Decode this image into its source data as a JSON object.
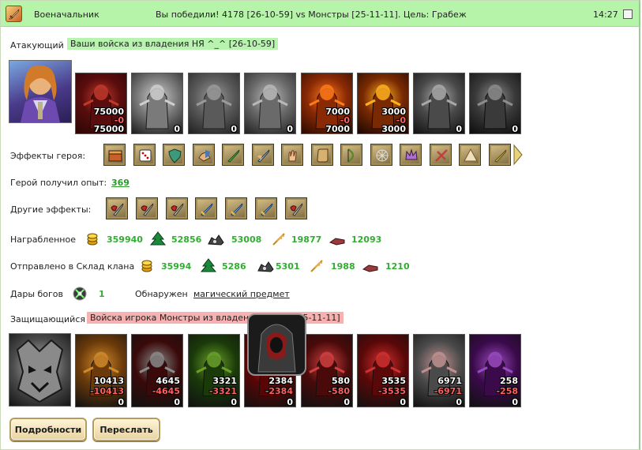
{
  "header": {
    "title": "Военачальник",
    "result": "Вы победили! 4178 [26-10-59] vs Монстры [25-11-11]. Цель: Грабеж",
    "time": "14:27",
    "colors": {
      "bg": "#b6f5a9"
    }
  },
  "attacker": {
    "label": "Атакующий",
    "tag": "Ваши войска из владения НЯ ^_^ [26-10-59]",
    "units": [
      {
        "icon": "red-dragon",
        "count": "75000",
        "loss": "-0",
        "remain": "75000"
      },
      {
        "icon": "skeleton-warrior",
        "count": "",
        "loss": "",
        "remain": "0"
      },
      {
        "icon": "ghoul",
        "count": "",
        "loss": "",
        "remain": "0"
      },
      {
        "icon": "gargoyle",
        "count": "",
        "loss": "",
        "remain": "0"
      },
      {
        "icon": "fire-elemental",
        "count": "7000",
        "loss": "-0",
        "remain": "7000"
      },
      {
        "icon": "fire-warrior",
        "count": "3000",
        "loss": "-0",
        "remain": "3000"
      },
      {
        "icon": "dark-knight",
        "count": "",
        "loss": "",
        "remain": "0"
      },
      {
        "icon": "hooded-reaper",
        "count": "",
        "loss": "",
        "remain": "0"
      }
    ]
  },
  "hero_effects": {
    "label": "Эффекты героя:",
    "icons": [
      "chest-icon",
      "dice-icon",
      "shield-icon",
      "hand-shield-icon",
      "green-sword-icon",
      "sword-hand-icon",
      "palm-icon",
      "scroll-icon",
      "bow-icon",
      "web-icon",
      "crown-icon",
      "crossbow-icon",
      "tent-icon",
      "sword-icon"
    ]
  },
  "experience": {
    "label": "Герой получил опыт:",
    "value": "369"
  },
  "other_effects": {
    "label": "Другие эффекты:",
    "icons": [
      "fist-sword-icon",
      "fist-sword-icon",
      "fist-sword-icon",
      "blue-sword-icon",
      "blue-sword-icon",
      "blue-sword-icon",
      "fist-sword-icon"
    ]
  },
  "looted": {
    "label": "Награбленное",
    "items": [
      {
        "icon": "gold-icon",
        "value": "359940"
      },
      {
        "icon": "wood-icon",
        "value": "52856"
      },
      {
        "icon": "ore-icon",
        "value": "53008"
      },
      {
        "icon": "grain-icon",
        "value": "19877"
      },
      {
        "icon": "stone-icon",
        "value": "12093"
      }
    ]
  },
  "clan_storage": {
    "label": "Отправлено в Склад клана",
    "items": [
      {
        "icon": "gold-icon",
        "value": "35994"
      },
      {
        "icon": "wood-icon",
        "value": "5286"
      },
      {
        "icon": "ore-icon",
        "value": "5301"
      },
      {
        "icon": "grain-icon",
        "value": "1988"
      },
      {
        "icon": "stone-icon",
        "value": "1210"
      }
    ]
  },
  "gods": {
    "label": "Дары богов",
    "value": "1",
    "found_label": "Обнаружен",
    "found_item": "магический предмет"
  },
  "defender": {
    "label": "Защищающийся",
    "tag": "Войска игрока Монстры из владения Руины [25-11-11]",
    "units": [
      {
        "icon": "pumpkin-ogre",
        "count": "10413",
        "loss": "-10413",
        "remain": "0"
      },
      {
        "icon": "red-golem",
        "count": "4645",
        "loss": "-4645",
        "remain": "0"
      },
      {
        "icon": "orc-warrior",
        "count": "3321",
        "loss": "-3321",
        "remain": "0"
      },
      {
        "icon": "red-demon",
        "count": "2384",
        "loss": "-2384",
        "remain": "0"
      },
      {
        "icon": "spider",
        "count": "580",
        "loss": "-580",
        "remain": "0"
      },
      {
        "icon": "red-beast",
        "count": "3535",
        "loss": "-3535",
        "remain": "0"
      },
      {
        "icon": "stone-titan",
        "count": "6971",
        "loss": "-6971",
        "remain": "0"
      },
      {
        "icon": "purple-demon",
        "count": "258",
        "loss": "-258",
        "remain": "0"
      }
    ]
  },
  "buttons": {
    "details": "Подробности",
    "forward": "Переслать"
  }
}
